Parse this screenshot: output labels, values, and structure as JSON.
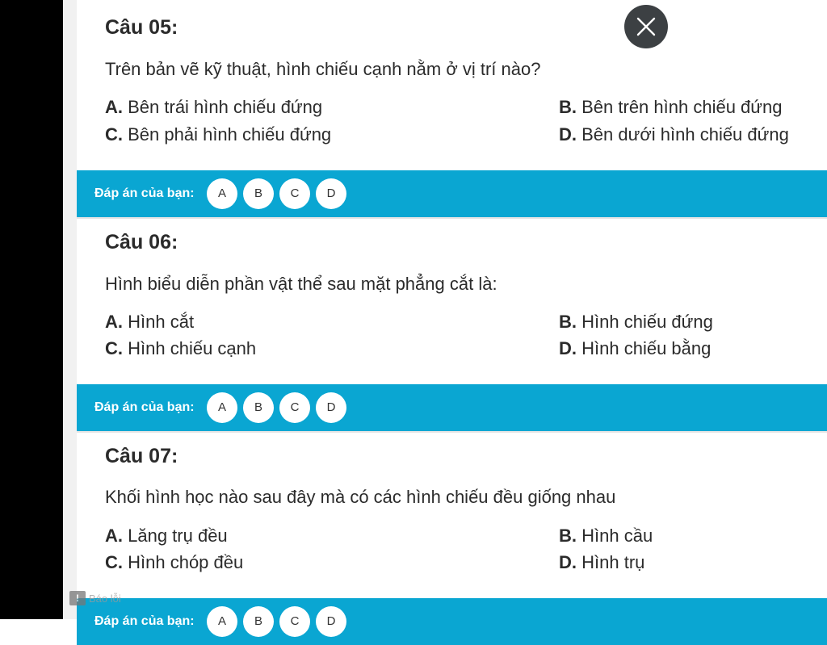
{
  "answer_label": "Đáp án của bạn:",
  "answer_options": [
    "A",
    "B",
    "C",
    "D"
  ],
  "report": "Báo lỗi",
  "questions": [
    {
      "title": "Câu 05:",
      "text": "Trên bản vẽ kỹ thuật, hình chiếu cạnh nằm ở vị trí nào?",
      "options": [
        {
          "letter": "A.",
          "text": "Bên trái hình chiếu đứng"
        },
        {
          "letter": "B.",
          "text": "Bên trên hình chiếu đứng"
        },
        {
          "letter": "C.",
          "text": "Bên phải hình chiếu đứng"
        },
        {
          "letter": "D.",
          "text": "Bên dưới hình chiếu đứng"
        }
      ]
    },
    {
      "title": "Câu 06:",
      "text": "Hình biểu diễn phần vật thể sau mặt phẳng cắt là:",
      "options": [
        {
          "letter": "A.",
          "text": "Hình cắt"
        },
        {
          "letter": "B.",
          "text": "Hình chiếu đứng"
        },
        {
          "letter": "C.",
          "text": "Hình chiếu cạnh"
        },
        {
          "letter": "D.",
          "text": "Hình chiếu bằng"
        }
      ]
    },
    {
      "title": "Câu 07:",
      "text": "Khối hình học nào sau đây mà có các hình chiếu đều giống nhau",
      "options": [
        {
          "letter": "A.",
          "text": "Lăng trụ đều"
        },
        {
          "letter": "B.",
          "text": "Hình cầu"
        },
        {
          "letter": "C.",
          "text": "Hình chóp đều"
        },
        {
          "letter": "D.",
          "text": "Hình trụ"
        }
      ]
    }
  ],
  "colors": {
    "accent": "#0aa6d2",
    "close_button": "#3c4043",
    "text": "#2b2b2b"
  },
  "icons": {
    "close": "close-icon",
    "report": "flag-icon"
  }
}
